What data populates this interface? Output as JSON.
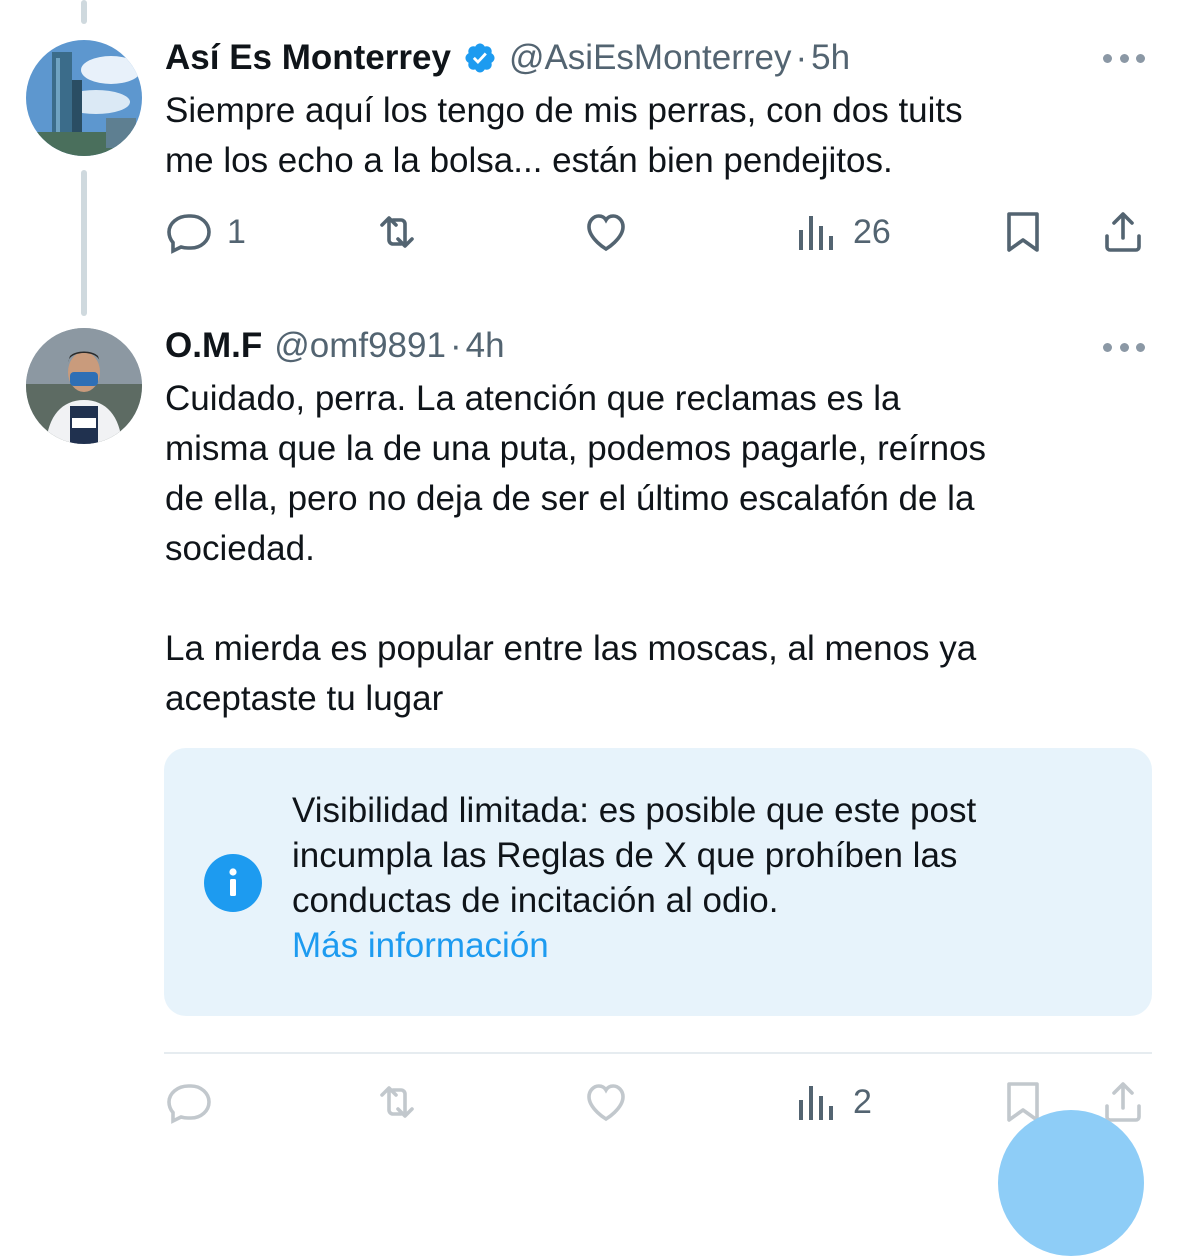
{
  "tweets": [
    {
      "name": "Así Es Monterrey",
      "handle": "@AsiEsMonterrey",
      "dot": "·",
      "time": "5h",
      "verified": true,
      "text": "Siempre aquí los tengo de mis perras, con dos tuits\nme los echo a la bolsa... están bien pendejitos.",
      "stats": {
        "replies": "1",
        "reposts": "",
        "likes": "",
        "views": "26"
      }
    },
    {
      "name": "O.M.F",
      "handle": "@omf9891",
      "dot": "·",
      "time": "4h",
      "verified": false,
      "text": "Cuidado, perra. La atención que reclamas es la\nmisma que la de una puta, podemos pagarle, reírnos\nde ella, pero no deja de ser el último escalafón de la\nsociedad.\n\nLa mierda es popular entre las moscas, al menos ya\naceptaste tu lugar",
      "stats": {
        "replies": "",
        "reposts": "",
        "likes": "",
        "views": "2"
      }
    }
  ],
  "notice": {
    "text": "Visibilidad limitada: es posible que este post incumpla las Reglas de X que prohíben las conductas de incitación al odio.",
    "link": "Más información"
  },
  "icons": [
    "verified-badge-icon",
    "more-icon",
    "reply-icon",
    "repost-icon",
    "like-icon",
    "views-icon",
    "bookmark-icon",
    "share-icon",
    "info-icon"
  ],
  "colors": {
    "accent": "#1d9bf0",
    "secondary_text": "#536471",
    "notice_bg": "#e7f3fb",
    "thread_line": "#cfd9de"
  }
}
